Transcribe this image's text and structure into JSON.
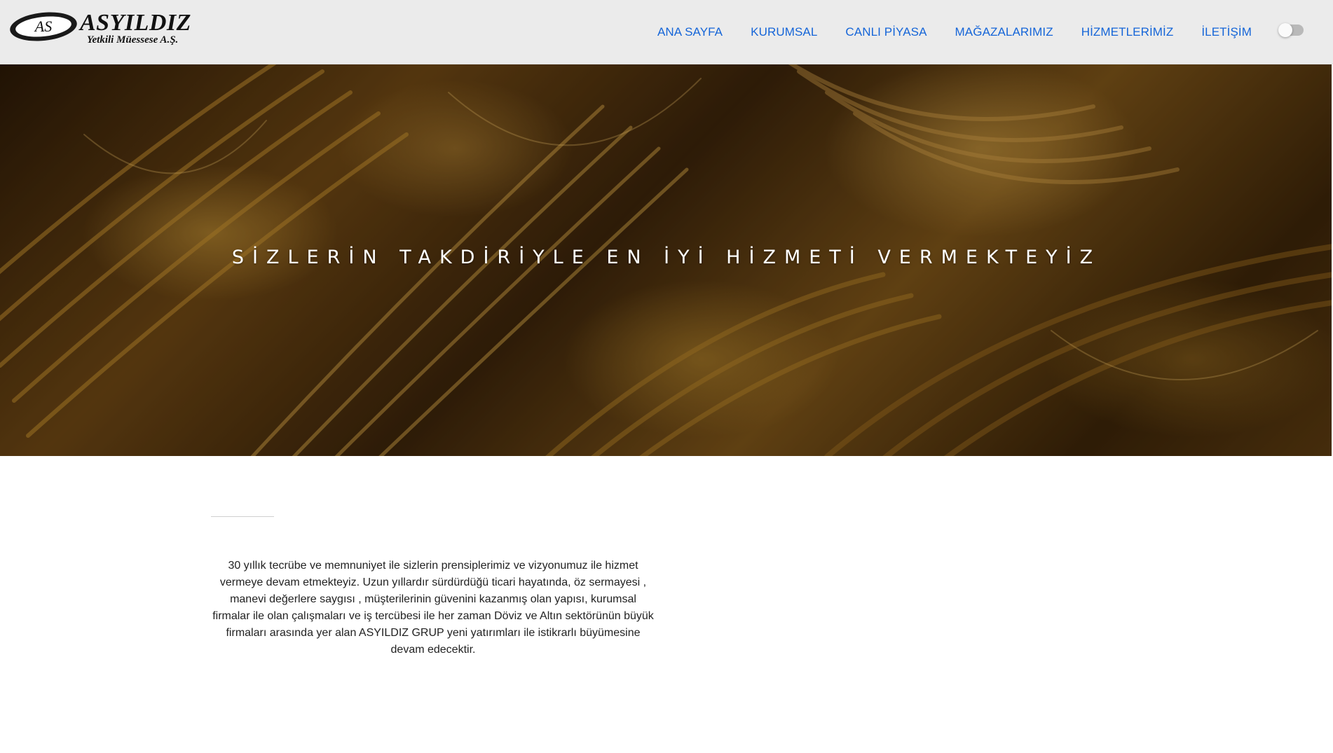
{
  "brand": {
    "logo_initials": "AS",
    "name": "ASYILDIZ",
    "tagline": "Yetkili Müessese A.Ş."
  },
  "nav": {
    "items": [
      {
        "label": "ANA SAYFA"
      },
      {
        "label": "KURUMSAL"
      },
      {
        "label": "CANLI PİYASA"
      },
      {
        "label": "MAĞAZALARIMIZ"
      },
      {
        "label": "HİZMETLERİMİZ"
      },
      {
        "label": "İLETİŞİM"
      }
    ],
    "theme_toggle": {
      "state": "off"
    }
  },
  "hero": {
    "title": "SİZLERİN TAKDİRİYLE EN İYİ HİZMETİ VERMEKTEYİZ",
    "image_subject": "gold-bangles"
  },
  "about": {
    "text": "30 yıllık tecrübe ve memnuniyet ile sizlerin prensiplerimiz ve vizyonumuz ile hizmet vermeye devam etmekteyiz. Uzun yıllardır sürdürdüğü ticari hayatında, öz sermayesi , manevi değerlere saygısı , müşterilerinin güvenini kazanmış olan yapısı, kurumsal firmalar ile olan çalışmaları ve iş tercübesi ile her zaman Döviz ve Altın sektörünün büyük firmaları arasında yer alan ASYILDIZ GRUP yeni yatırımları ile istikrarlı büyümesine devam edecektir."
  },
  "colors": {
    "header_bg": "#ebebeb",
    "nav_link": "#1565d8",
    "hero_text": "#ffffff",
    "body_text": "#222222",
    "gold_dark": "#3a230a",
    "gold_light": "#d9a441"
  }
}
